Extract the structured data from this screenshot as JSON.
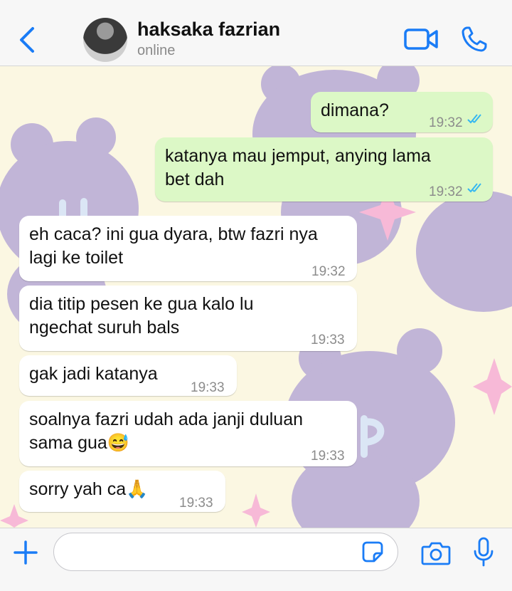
{
  "header": {
    "back_icon": "chevron-left-icon",
    "contact_name": "haksaka fazrian",
    "status": "online",
    "video_icon": "video-camera-icon",
    "phone_icon": "phone-icon"
  },
  "colors": {
    "accent": "#1a7cf6",
    "outgoing_bubble": "#dcf8c6",
    "incoming_bubble": "#ffffff",
    "wallpaper": "#fbf7e2",
    "wallpaper_bear": "#bbaed6",
    "wallpaper_star": "#f7b9d7",
    "read_ticks": "#34b7f1"
  },
  "messages": [
    {
      "direction": "outgoing",
      "lines": [
        "dimana?"
      ],
      "time": "19:32",
      "status": "read"
    },
    {
      "direction": "outgoing",
      "lines": [
        "katanya mau jemput, anying lama",
        "bet dah"
      ],
      "time": "19:32",
      "status": "read"
    },
    {
      "direction": "incoming",
      "lines": [
        "eh caca? ini gua dyara, btw fazri nya",
        "lagi ke toilet"
      ],
      "time": "19:32"
    },
    {
      "direction": "incoming",
      "lines": [
        "dia titip pesen ke gua kalo lu",
        "ngechat suruh bals"
      ],
      "time": "19:33"
    },
    {
      "direction": "incoming",
      "lines": [
        "gak jadi katanya"
      ],
      "time": "19:33"
    },
    {
      "direction": "incoming",
      "lines": [
        "soalnya fazri udah ada janji duluan",
        "sama gua😅"
      ],
      "time": "19:33"
    },
    {
      "direction": "incoming",
      "lines": [
        "sorry yah ca🙏"
      ],
      "time": "19:33"
    }
  ],
  "composer": {
    "plus_icon": "plus-icon",
    "input_value": "",
    "input_placeholder": "",
    "sticker_icon": "sticker-icon",
    "camera_icon": "camera-icon",
    "mic_icon": "microphone-icon"
  }
}
